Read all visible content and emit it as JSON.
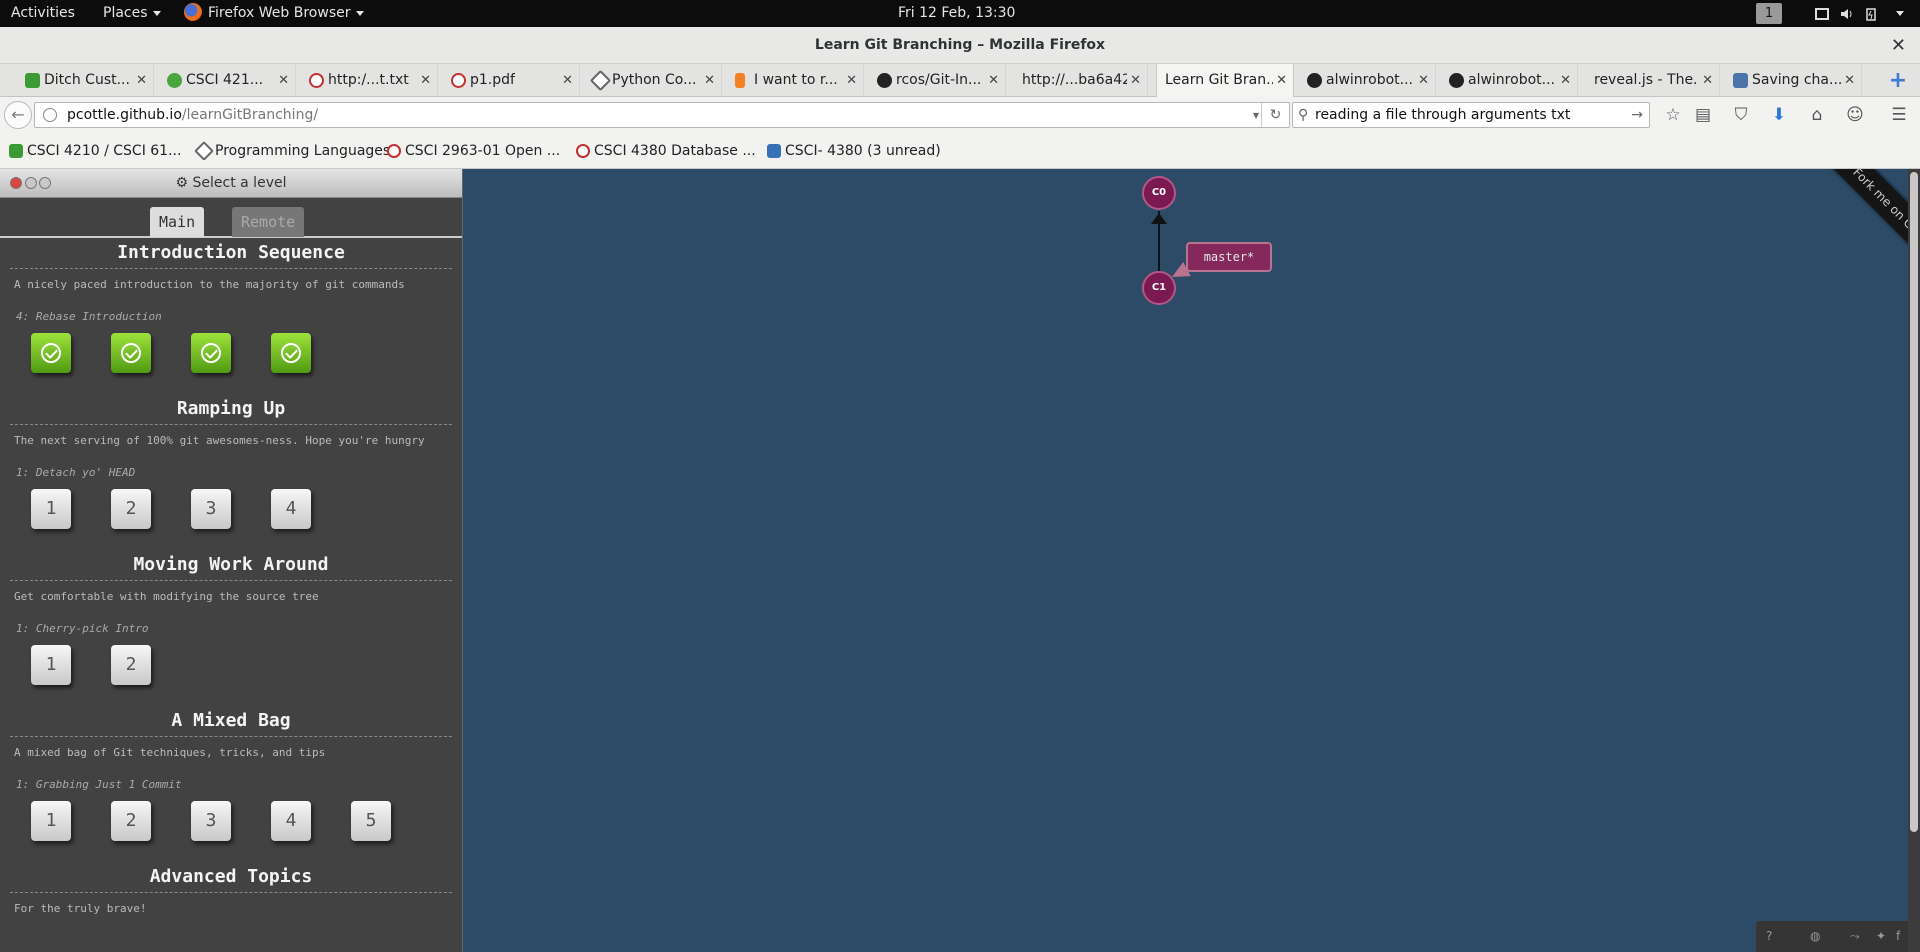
{
  "gnome": {
    "activities": "Activities",
    "places": "Places",
    "app": "Firefox Web Browser",
    "clock": "Fri 12 Feb, 13:30",
    "workspace": "1"
  },
  "window": {
    "title": "Learn Git Branching – Mozilla Firefox"
  },
  "tabs": [
    {
      "label": "Ditch Cust...",
      "icon": "green-square-icon"
    },
    {
      "label": "CSCI 421...",
      "icon": "green-c-icon"
    },
    {
      "label": "http:/...t.txt",
      "icon": "cs-logo-icon"
    },
    {
      "label": "p1.pdf",
      "icon": "cs-logo-icon"
    },
    {
      "label": "Python Co...",
      "icon": "python-diamond-icon"
    },
    {
      "label": "I want to r...",
      "icon": "stackoverflow-icon"
    },
    {
      "label": "rcos/Git-In...",
      "icon": "github-icon"
    },
    {
      "label": "http://...ba6a42",
      "icon": "none"
    },
    {
      "label": "Learn Git Bran...",
      "icon": "none",
      "active": true
    },
    {
      "label": "alwinrobot...",
      "icon": "github-icon"
    },
    {
      "label": "alwinrobot...",
      "icon": "github-icon"
    },
    {
      "label": "reveal.js - The...",
      "icon": "none"
    },
    {
      "label": "Saving cha...",
      "icon": "database-icon"
    }
  ],
  "nav": {
    "url_host": "pcottle.github.io",
    "url_path": "/learnGitBranching/",
    "search_value": "reading a file through arguments txt"
  },
  "bookmarks": [
    {
      "label": "CSCI 4210 / CSCI 61...",
      "icon": "green-square-icon"
    },
    {
      "label": "Programming Languages",
      "icon": "gear-icon"
    },
    {
      "label": "CSCI 2963-01 Open ...",
      "icon": "cs-logo-icon"
    },
    {
      "label": "CSCI 4380 Database ...",
      "icon": "cs-logo-icon"
    },
    {
      "label": "CSCI- 4380 (3 unread)",
      "icon": "piazza-icon"
    }
  ],
  "panel": {
    "title": "Select a level",
    "tab_main": "Main",
    "tab_remote": "Remote",
    "sequences": [
      {
        "title": "Introduction Sequence",
        "about": "A nicely paced introduction to the majority of git commands",
        "current": "4: Rebase Introduction",
        "levels": [
          "",
          "",
          "",
          ""
        ],
        "completed": 4
      },
      {
        "title": "Ramping Up",
        "about": "The next serving of 100% git awesomes-ness. Hope you're hungry",
        "current": "1: Detach yo' HEAD",
        "levels": [
          "1",
          "2",
          "3",
          "4"
        ],
        "completed": 0
      },
      {
        "title": "Moving Work Around",
        "about": "Get comfortable with modifying the source tree",
        "current": "1: Cherry-pick Intro",
        "levels": [
          "1",
          "2"
        ],
        "completed": 0
      },
      {
        "title": "A Mixed Bag",
        "about": "A mixed bag of Git techniques, tricks, and tips",
        "current": "1: Grabbing Just 1 Commit",
        "levels": [
          "1",
          "2",
          "3",
          "4",
          "5"
        ],
        "completed": 0
      },
      {
        "title": "Advanced Topics",
        "about": "For the truly brave!",
        "current": "",
        "levels": [],
        "completed": 0
      }
    ]
  },
  "graph": {
    "commits": [
      "C0",
      "C1"
    ],
    "branch_label": "master*"
  },
  "ribbon": "Fork me on GitHub",
  "colors": {
    "canvas": "#2d4b66",
    "commit": "#7b1a52",
    "panel": "#424242"
  }
}
